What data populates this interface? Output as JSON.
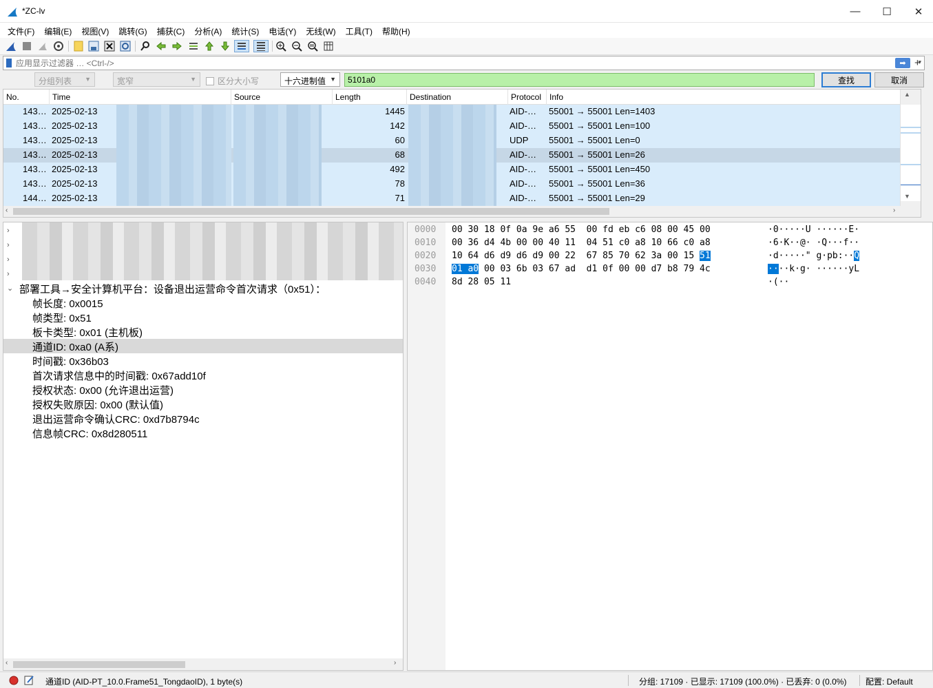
{
  "window": {
    "title": "*ZC-lv",
    "minimize": "—",
    "maximize": "☐",
    "close": "✕"
  },
  "menu": [
    "文件(F)",
    "编辑(E)",
    "视图(V)",
    "跳转(G)",
    "捕获(C)",
    "分析(A)",
    "统计(S)",
    "电话(Y)",
    "无线(W)",
    "工具(T)",
    "帮助(H)"
  ],
  "filter": {
    "placeholder": "应用显示过滤器 … <Ctrl-/>",
    "apply_glyph": "➡",
    "dropdown_glyph": "▾",
    "add_glyph": "+"
  },
  "find": {
    "scope": "分组列表",
    "charset": "宽窄",
    "case_sensitive_label": "区分大小写",
    "type": "十六进制值",
    "value": "5101a0",
    "find_button": "查找",
    "cancel_button": "取消"
  },
  "packet_list": {
    "columns": [
      "No.",
      "Time",
      "Source",
      "Length",
      "Destination",
      "Protocol",
      "Info"
    ],
    "rows": [
      {
        "no": "143…",
        "time": "2025-02-13",
        "length": "1445",
        "protocol": "AID-…",
        "info": "55001 → 55001 Len=1403",
        "selected": false
      },
      {
        "no": "143…",
        "time": "2025-02-13",
        "length": "142",
        "protocol": "AID-…",
        "info": "55001 → 55001 Len=100",
        "selected": false
      },
      {
        "no": "143…",
        "time": "2025-02-13",
        "length": "60",
        "protocol": "UDP",
        "info": "55001 → 55001 Len=0",
        "selected": false
      },
      {
        "no": "143…",
        "time": "2025-02-13",
        "length": "68",
        "protocol": "AID-…",
        "info": "55001 → 55001 Len=26",
        "selected": true
      },
      {
        "no": "143…",
        "time": "2025-02-13",
        "length": "492",
        "protocol": "AID-…",
        "info": "55001 → 55001 Len=450",
        "selected": false
      },
      {
        "no": "143…",
        "time": "2025-02-13",
        "length": "78",
        "protocol": "AID-…",
        "info": "55001 → 55001 Len=36",
        "selected": false
      },
      {
        "no": "144…",
        "time": "2025-02-13",
        "length": "71",
        "protocol": "AID-…",
        "info": "55001 → 55001 Len=29",
        "selected": false
      }
    ]
  },
  "details": {
    "header": "部署工具→安全计算机平台：设备退出运营命令首次请求（0x51）：",
    "fields": [
      {
        "text": "帧长度: 0x0015",
        "selected": false
      },
      {
        "text": "帧类型: 0x51",
        "selected": false
      },
      {
        "text": "板卡类型: 0x01 (主机板)",
        "selected": false
      },
      {
        "text": "通道ID: 0xa0 (A系)",
        "selected": true
      },
      {
        "text": "时间戳: 0x36b03",
        "selected": false
      },
      {
        "text": "首次请求信息中的时间戳: 0x67add10f",
        "selected": false
      },
      {
        "text": "授权状态: 0x00 (允许退出运营)",
        "selected": false
      },
      {
        "text": "授权失败原因: 0x00 (默认值)",
        "selected": false
      },
      {
        "text": "退出运营命令确认CRC: 0xd7b8794c",
        "selected": false
      },
      {
        "text": "信息帧CRC: 0x8d280511",
        "selected": false
      }
    ]
  },
  "bytes": {
    "offsets": [
      "0000",
      "0010",
      "0020",
      "0030",
      "0040"
    ],
    "hex_rows": [
      {
        "before": "00 30 18 0f 0a 9e a6 55  00 fd eb c6 08 00 45 00",
        "hl": "",
        "after": ""
      },
      {
        "before": "00 36 d4 4b 00 00 40 11  04 51 c0 a8 10 66 c0 a8",
        "hl": "",
        "after": ""
      },
      {
        "before": "10 64 d6 d9 d6 d9 00 22  67 85 70 62 3a 00 15 ",
        "hl": "51",
        "after": ""
      },
      {
        "before": "",
        "hl": "01 a0",
        "after": " 00 03 6b 03 67 ad  d1 0f 00 00 d7 b8 79 4c"
      },
      {
        "before": "8d 28 05 11",
        "hl": "",
        "after": ""
      }
    ],
    "ascii_rows": [
      {
        "before": "·0·····U ······E·",
        "hl": "",
        "after": ""
      },
      {
        "before": "·6·K··@· ·Q···f··",
        "hl": "",
        "after": ""
      },
      {
        "before": "·d·····\" g·pb:··",
        "hl": "Q",
        "after": ""
      },
      {
        "before": "",
        "hl": "··",
        "after": "··k·g· ······yL"
      },
      {
        "before": "·(··",
        "hl": "",
        "after": ""
      }
    ]
  },
  "status": {
    "field_info": "通道ID (AID-PT_10.0.Frame51_TongdaoID), 1 byte(s)",
    "packets": "分组: 17109 · 已显示: 17109 (100.0%) · 已丢弃: 0 (0.0%)",
    "profile": "配置: Default"
  },
  "icons": [
    "shark-fin-icon",
    "stop-icon",
    "restart-icon",
    "options-icon",
    "open-icon",
    "save-icon",
    "close-file-icon",
    "reload-icon",
    "find-icon",
    "back-icon",
    "forward-icon",
    "goto-icon",
    "first-icon",
    "last-icon",
    "autoscroll-icon",
    "colorize-icon",
    "zoom-in-icon",
    "zoom-out-icon",
    "zoom-reset-icon",
    "resize-columns-icon"
  ],
  "colors": {
    "row_bg": "#d9ecfb",
    "row_selected": "#c6d7e6",
    "find_bg": "#b8f0a8",
    "byte_highlight": "#0078d7"
  }
}
